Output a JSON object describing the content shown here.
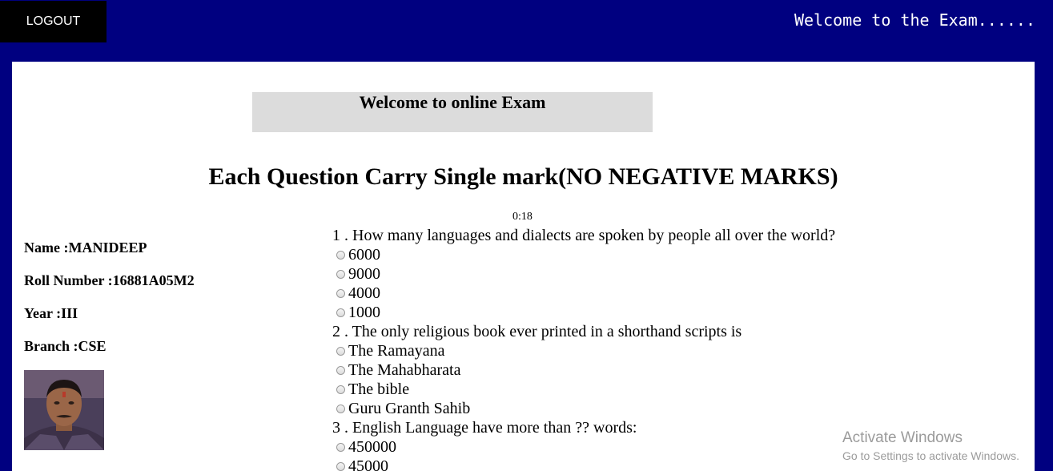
{
  "header": {
    "logout_label": "LOGOUT",
    "marquee_text": "Welcome to the Exam......"
  },
  "main": {
    "banner": "Welcome to online Exam",
    "rule": "Each Question Carry Single mark(NO NEGATIVE MARKS)",
    "timer": "0:18"
  },
  "profile": {
    "name": "Name :MANIDEEP",
    "roll": "Roll Number :16881A05M2",
    "year": "Year :III",
    "branch": "Branch :CSE"
  },
  "questions": [
    {
      "text": "1 . How many languages and dialects are spoken by people all over the world?",
      "options": [
        "6000",
        "9000",
        "4000",
        "1000"
      ]
    },
    {
      "text": "2 . The only religious book ever printed in a shorthand scripts is",
      "options": [
        "The Ramayana",
        "The Mahabharata",
        "The bible",
        "Guru Granth Sahib"
      ]
    },
    {
      "text": "3 . English Language have more than ?? words:",
      "options": [
        "450000",
        "45000"
      ]
    }
  ],
  "watermark": {
    "line1": "Activate Windows",
    "line2": "Go to Settings to activate Windows."
  },
  "colors": {
    "page_bg": "#000080",
    "logout_bg": "#000000",
    "banner_bg": "#dcdcdc"
  }
}
